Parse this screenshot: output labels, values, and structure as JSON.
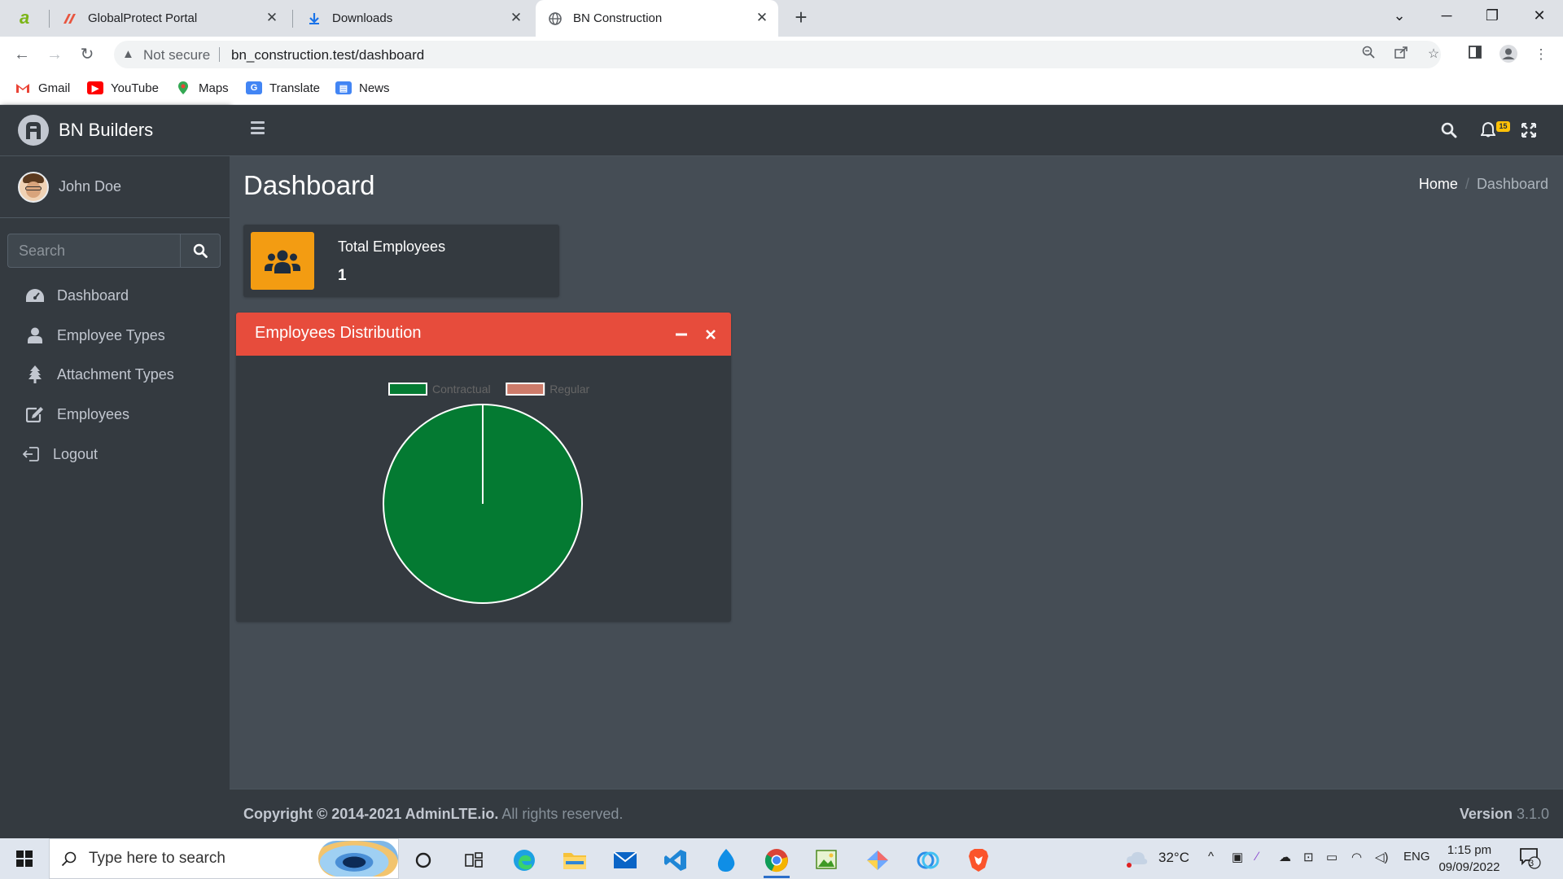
{
  "browser": {
    "tabs": [
      {
        "title": "GlobalProtect Portal"
      },
      {
        "title": "Downloads"
      },
      {
        "title": "BN Construction"
      }
    ],
    "address": {
      "security": "Not secure",
      "url": "bn_construction.test/dashboard"
    },
    "bookmarks": [
      {
        "label": "Gmail"
      },
      {
        "label": "YouTube"
      },
      {
        "label": "Maps"
      },
      {
        "label": "Translate"
      },
      {
        "label": "News"
      }
    ]
  },
  "app": {
    "brand": "BN Builders",
    "user": "John Doe",
    "sidebar_search_placeholder": "Search",
    "nav": [
      {
        "label": "Dashboard",
        "icon": "tachometer-icon"
      },
      {
        "label": "Employee Types",
        "icon": "user-icon"
      },
      {
        "label": "Attachment Types",
        "icon": "tree-icon"
      },
      {
        "label": "Employees",
        "icon": "edit-icon"
      },
      {
        "label": "Logout",
        "icon": "sign-out-icon"
      }
    ],
    "notifications_count": "15",
    "page_title": "Dashboard",
    "breadcrumb": {
      "home": "Home",
      "current": "Dashboard"
    },
    "info_box": {
      "label": "Total Employees",
      "value": "1"
    },
    "card": {
      "title": "Employees Distribution"
    },
    "footer": {
      "copyright_bold": "Copyright © 2014-2021 AdminLTE.io.",
      "rights": "All rights reserved.",
      "version_label": "Version",
      "version": "3.1.0"
    }
  },
  "chart_data": {
    "type": "pie",
    "title": "",
    "categories": [
      "Contractual",
      "Regular"
    ],
    "values": [
      1,
      0
    ],
    "colors": [
      "#047a32",
      "#cd7b6a"
    ],
    "legend": "top"
  },
  "taskbar": {
    "search_placeholder": "Type here to search",
    "weather": "32°C",
    "language": "ENG",
    "time": "1:15 pm",
    "date": "09/09/2022",
    "notifications": "3"
  }
}
